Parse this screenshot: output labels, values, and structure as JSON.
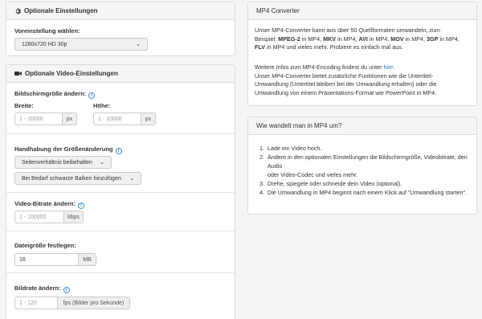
{
  "optional_settings": {
    "title": "Optionale Einstellungen",
    "preset_label": "Voreinstellung wählen:",
    "preset_value": "1280x720 HD 30p"
  },
  "video_settings": {
    "title": "Optionale Video-Einstellungen",
    "screen_size_label": "Bildschirmgröße ändern:",
    "width_label": "Breite:",
    "width_placeholder": "1 - 10000",
    "width_unit": "px",
    "height_label": "Höhe:",
    "height_placeholder": "1 - 10000",
    "height_unit": "px",
    "resize_label": "Handhabung der Größenänderung",
    "aspect_value": "Seitenverhältnis beibehalten",
    "bars_value": "Bei Bedarf schwarze Balken hinzufügen",
    "bitrate_label": "Video-Bitrate ändern:",
    "bitrate_placeholder": "1 - 100000",
    "bitrate_unit": "kbps",
    "filesize_label": "Dateigröße festlegen:",
    "filesize_value": "16",
    "filesize_unit": "MB",
    "framerate_label": "Bildrate ändern:",
    "framerate_placeholder": "1 - 120",
    "framerate_unit": "fps (Bilder pro Sekunde)"
  },
  "converter": {
    "title": "MP4 Converter",
    "p1_a": "Unser MP4-Converter kann aus über 50 Quellformaten umwandeln, zum",
    "p1_b": "Beispiel: ",
    "f1": "MPEG-2",
    "p1_c": " in MP4, ",
    "f2": "MKV",
    "p1_d": " in MP4, ",
    "f3": "AVI",
    "p1_e": " in MP4, ",
    "f4": "MOV",
    "p1_f": " in MP4, ",
    "f5": "3GP",
    "p1_g": " in MP4,",
    "f6": "FLV",
    "p1_h": " in MP4 und vieles mehr. Probiere es einfach mal aus.",
    "p2_a": "Weitere Infos zum MP4-Encoding findest du unter ",
    "p2_link": "hier",
    "p2_b": ".",
    "p3_a": "Unser MP4-Converter bietet zusätzliche Funktionen wie die Untertitel-",
    "p3_b": "Umwandlung (Untertitel bleiben bei der Umwandlung erhalten) oder die",
    "p3_c": "Umwandlung von einem Präsentations-Format wie PowerPoint in MP4."
  },
  "howto": {
    "title": "Wie wandelt man in MP4 um?",
    "steps": [
      "Lade ein Video hoch.",
      "Ändere in den optionalen Einstellungen die Bildschirmgröße, Videobitrate, den Audio",
      "oder Video-Codec und vieles mehr.",
      "Drehe, spiegele oder schneide dein Video (optional).",
      "Die Umwandlung in MP4 beginnt nach einem Klick auf \"Umwandlung starten\"."
    ]
  },
  "icons": {
    "settings": "gear-icon",
    "video": "video-camera-icon",
    "info": "info-icon",
    "chevron": "chevron-down-icon"
  },
  "colors": {
    "link": "#2a7ac7",
    "info": "#3a8fd8"
  }
}
